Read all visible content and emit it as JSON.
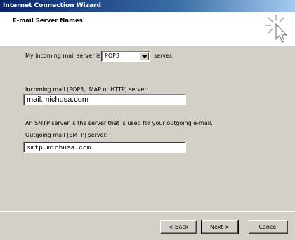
{
  "window": {
    "title": "Internet Connection Wizard"
  },
  "header": {
    "title": "E-mail Server Names",
    "icon": "wizard-sparkle-icon"
  },
  "incoming_type": {
    "label_before": "My incoming mail server is a",
    "selected": "POP3",
    "label_after": "server."
  },
  "incoming": {
    "label": "Incoming mail (POP3, IMAP or HTTP) server:",
    "value": "mail.michusa.com"
  },
  "smtp_note": "An SMTP server is the server that is used for your outgoing e-mail.",
  "outgoing": {
    "label": "Outgoing mail (SMTP) server:",
    "value": "smtp.michusa.com"
  },
  "buttons": {
    "back": "< Back",
    "next": "Next >",
    "cancel": "Cancel"
  }
}
